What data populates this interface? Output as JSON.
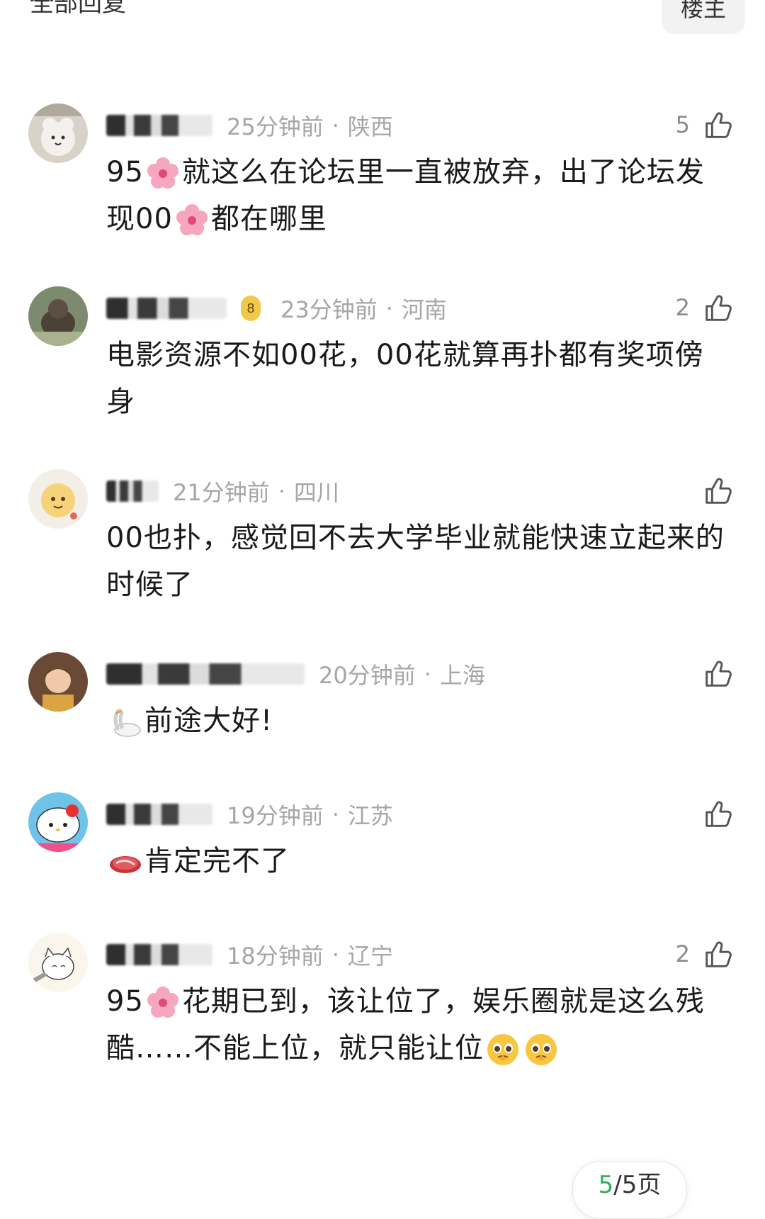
{
  "header": {
    "title": "全部回复",
    "op_filter_label": "楼主"
  },
  "comments": [
    {
      "time": "25分钟前",
      "location": "陕西",
      "likes": "5",
      "text_parts": [
        "95",
        "就这么在论坛里一直被放弃，出了论坛发现00",
        "都在哪里"
      ],
      "emojis": [
        "cherry-blossom-emoji",
        "cherry-blossom-emoji"
      ]
    },
    {
      "time": "23分钟前",
      "location": "河南",
      "likes": "2",
      "text": "电影资源不如00花，00花就算再扑都有奖项傍身"
    },
    {
      "time": "21分钟前",
      "location": "四川",
      "likes": "",
      "text": "00也扑，感觉回不去大学毕业就能快速立起来的时候了"
    },
    {
      "time": "20分钟前",
      "location": "上海",
      "likes": "",
      "text": "前途大好!",
      "emojis": [
        "swan-emoji"
      ]
    },
    {
      "time": "19分钟前",
      "location": "江苏",
      "likes": "",
      "text": "肯定完不了",
      "emojis": [
        "meat-emoji"
      ]
    },
    {
      "time": "18分钟前",
      "location": "辽宁",
      "likes": "2",
      "text_parts": [
        "95",
        "花期已到，该让位了，娱乐圈就是这么残酷……不能上位，就只能让位"
      ],
      "emojis": [
        "cherry-blossom-emoji",
        "pleading-face-emoji",
        "pleading-face-emoji"
      ]
    }
  ],
  "pager": {
    "current": "5",
    "rest": "/5页"
  },
  "colors": {
    "meta_gray": "#a6a6a6",
    "text": "#1a1a1a",
    "pager_accent": "#2fae5c"
  }
}
